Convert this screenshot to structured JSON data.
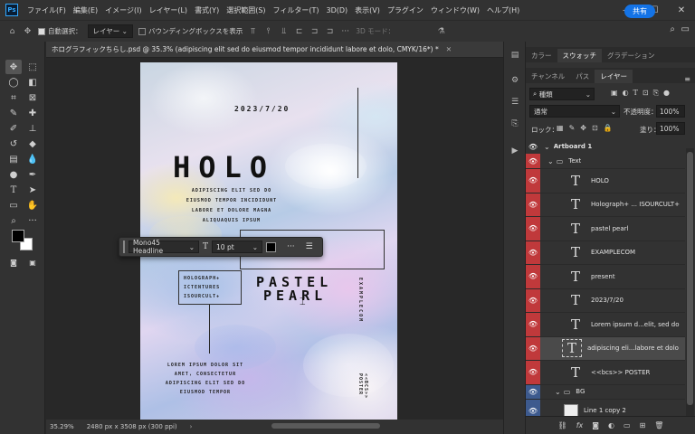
{
  "menu": {
    "app_logo": "Ps",
    "items": [
      "ファイル(F)",
      "編集(E)",
      "イメージ(I)",
      "レイヤー(L)",
      "書式(Y)",
      "選択範囲(S)",
      "フィルター(T)",
      "3D(D)",
      "表示(V)",
      "プラグイン",
      "ウィンドウ(W)",
      "ヘルプ(H)"
    ]
  },
  "options": {
    "auto_select_label": "自動選択：",
    "auto_select_value": "レイヤー",
    "bounding_box_label": "バウンディングボックスを表示",
    "mode_3d_label": "3D モード：",
    "share_label": "共有"
  },
  "document": {
    "tab_title": "ホログラフィックちらし.psd @ 35.3% (adipiscing elit sed do eiusmod tempor incididunt labore et dolo, CMYK/16*) *"
  },
  "artboard": {
    "date": "2023/7/20",
    "holo": "HOLO",
    "lorem_top": "ADIPISCING ELIT SED DO EIUSMOD TEMPOR INCIDIDUNT LABORE ET DOLORE MAGNA ALIQUAQUIS IPSUM",
    "holograph": "HOLOGRAPH+ ICTENTURES ISOURCULT+",
    "pastel": "PASTEL",
    "pearl": "PEARL",
    "example": "EXAMPLECOM",
    "lorem_bottom": "LOREM IPSUM DOLOR SIT AMET, CONSECTETUR ADIPISCING ELIT SED DO EIUSMOD TEMPOR",
    "poster": "<<BCS>> POSTER"
  },
  "floating_toolbar": {
    "font": "Mono45 Headline",
    "size": "10 pt",
    "more": "···"
  },
  "status": {
    "zoom": "35.29%",
    "dimensions": "2480 px x 3508 px (300 ppi)"
  },
  "panels": {
    "top_tabs": [
      "カラー",
      "スウォッチ",
      "グラデーション"
    ],
    "top_active": 1,
    "layer_tabs": [
      "チャンネル",
      "パス",
      "レイヤー"
    ],
    "layer_active": 2,
    "filter_kind": "種類",
    "blend_mode": "通常",
    "opacity_label": "不透明度：",
    "opacity_value": "100%",
    "lock_label": "ロック：",
    "fill_label": "塗り：",
    "fill_value": "100%"
  },
  "layers": [
    {
      "name": "Artboard 1",
      "kind": "artboard",
      "color": "none"
    },
    {
      "name": "Text",
      "kind": "group",
      "color": "red"
    },
    {
      "name": "HOLO",
      "kind": "text",
      "color": "red"
    },
    {
      "name": "Holograph+ ... ISOURCULT+",
      "kind": "text",
      "color": "red"
    },
    {
      "name": "pastel pearl",
      "kind": "text",
      "color": "red"
    },
    {
      "name": "EXAMPLECOM",
      "kind": "text",
      "color": "red"
    },
    {
      "name": "present",
      "kind": "text",
      "color": "red"
    },
    {
      "name": "2023/7/20",
      "kind": "text",
      "color": "red"
    },
    {
      "name": "Lorem ipsum d...elit, sed do",
      "kind": "text",
      "color": "red"
    },
    {
      "name": "adipiscing eli...labore et dolo",
      "kind": "text",
      "color": "red",
      "selected": true
    },
    {
      "name": "<<bcs>> POSTER",
      "kind": "text",
      "color": "red"
    },
    {
      "name": "BG",
      "kind": "group",
      "color": "blue"
    },
    {
      "name": "Line 1 copy 2",
      "kind": "shape",
      "color": "blue"
    }
  ],
  "colors": {
    "accent": "#1473e6",
    "layer_red": "#c0393b",
    "layer_blue": "#3d5a8e"
  }
}
